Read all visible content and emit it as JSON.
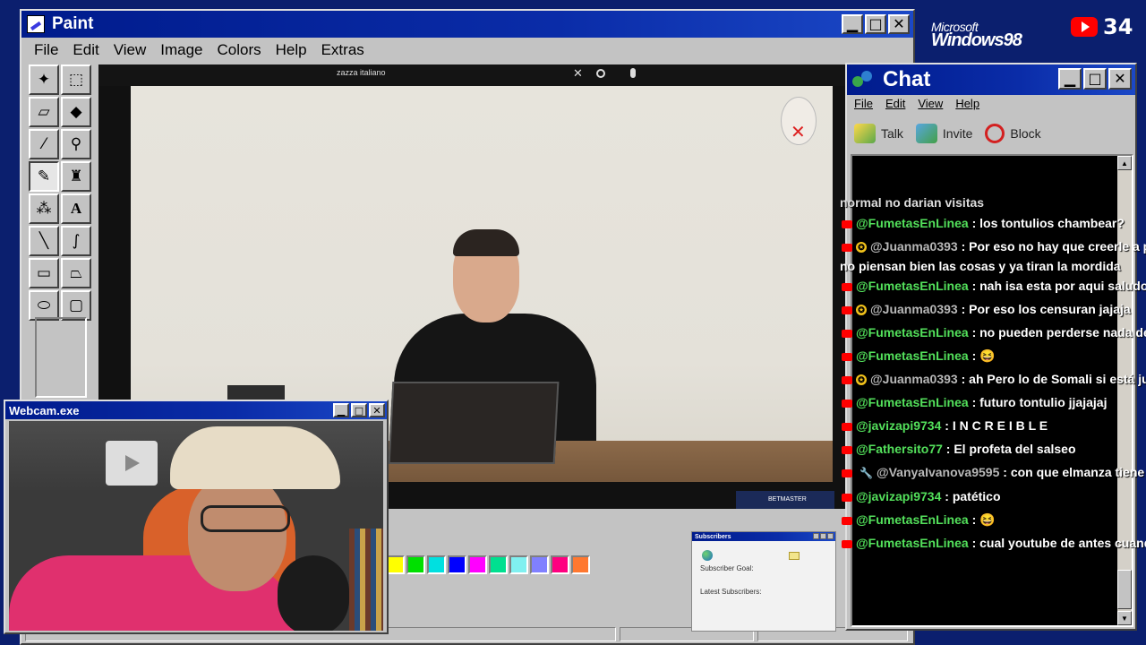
{
  "branding": {
    "ms_label": "Microsoft",
    "os_label": "Windows98",
    "yt_count": "34"
  },
  "paint": {
    "title": "Paint",
    "menu": [
      "File",
      "Edit",
      "View",
      "Image",
      "Colors",
      "Help",
      "Extras"
    ],
    "tools": [
      "free-select",
      "rect-select",
      "eraser",
      "fill",
      "eyedropper",
      "magnifier",
      "pencil",
      "brush",
      "airbrush",
      "text",
      "line",
      "curve",
      "rectangle",
      "polygon",
      "ellipse",
      "rounded-rect"
    ],
    "active_tool": "pencil",
    "palette": [
      "#ff0000",
      "#ffff00",
      "#00e000",
      "#00e0e0",
      "#0000ff",
      "#ff00ff",
      "#00e090",
      "#80f0f0",
      "#8080ff",
      "#ff0080",
      "#ff7830"
    ]
  },
  "video": {
    "search_text": "zazza italiano",
    "close_glyph": "✕",
    "sponsor": "BETMASTER"
  },
  "subscribers": {
    "title": "Subscribers",
    "goal_label": "Subscriber Goal:",
    "latest_label": "Latest Subscribers:"
  },
  "webcam": {
    "title": "Webcam.exe"
  },
  "chat": {
    "title": "Chat",
    "menu": [
      "File",
      "Edit",
      "View",
      "Help"
    ],
    "toolbar": {
      "talk": "Talk",
      "invite": "Invite",
      "block": "Block"
    },
    "partial_top": "normal no darian visitas",
    "messages": [
      {
        "badge": "none",
        "user": "@FumetasEnLinea",
        "text": ": los tontulios chambear?",
        "user_color": "green"
      },
      {
        "badge": "star",
        "user": "@Juanma0393",
        "text": ": Por eso no hay que creerle a pe",
        "user_color": "grey",
        "cont": "no piensan bien las cosas y ya tiran la mordida"
      },
      {
        "badge": "none",
        "user": "@FumetasEnLinea",
        "text": ": nah isa esta por aqui saludos",
        "user_color": "green"
      },
      {
        "badge": "star",
        "user": "@Juanma0393",
        "text": ": Por eso los censuran jajaja",
        "user_color": "grey"
      },
      {
        "badge": "none",
        "user": "@FumetasEnLinea",
        "text": ": no pueden perderse nada de su",
        "user_color": "green"
      },
      {
        "badge": "none",
        "user": "@FumetasEnLinea",
        "text": ": 😆",
        "user_color": "green"
      },
      {
        "badge": "star",
        "user": "@Juanma0393",
        "text": ": ah Pero lo de Somali si está just",
        "user_color": "grey"
      },
      {
        "badge": "none",
        "user": "@FumetasEnLinea",
        "text": ": futuro tontulio jjajajaj",
        "user_color": "green"
      },
      {
        "badge": "none",
        "user": "@javizapi9734",
        "text": ": I N C R E I B L E",
        "user_color": "green"
      },
      {
        "badge": "none",
        "user": "@Fathersito77",
        "text": ": El profeta del salseo",
        "user_color": "green"
      },
      {
        "badge": "wrench",
        "user": "@VanyaIvanova9595",
        "text": ": con que elmanza tiene un",
        "user_color": "grey"
      },
      {
        "badge": "none",
        "user": "@javizapi9734",
        "text": ": patético",
        "user_color": "green"
      },
      {
        "badge": "none",
        "user": "@FumetasEnLinea",
        "text": ": 😆",
        "user_color": "green"
      },
      {
        "badge": "none",
        "user": "@FumetasEnLinea",
        "text": ": cual youtube de antes cuando",
        "user_color": "green"
      }
    ]
  }
}
